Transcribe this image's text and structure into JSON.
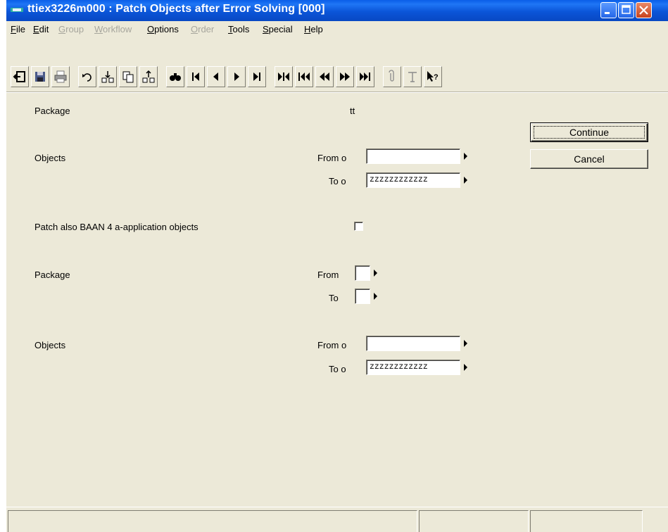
{
  "window": {
    "title": "ttiex3226m000 : Patch Objects after Error Solving [000]"
  },
  "menubar": {
    "items": [
      {
        "label": "File",
        "disabled": false
      },
      {
        "label": "Edit",
        "disabled": false
      },
      {
        "label": "Group",
        "disabled": true
      },
      {
        "label": "Workflow",
        "disabled": true
      },
      {
        "label": "Options",
        "disabled": false
      },
      {
        "label": "Order",
        "disabled": true
      },
      {
        "label": "Tools",
        "disabled": false
      },
      {
        "label": "Special",
        "disabled": false
      },
      {
        "label": "Help",
        "disabled": false
      }
    ]
  },
  "toolbar": {
    "icons": [
      "exit-icon",
      "save-icon",
      "print-icon",
      "undo-icon",
      "insert-icon",
      "copy-icon",
      "duplicate-icon",
      "find-icon",
      "first-record-icon",
      "previous-record-icon",
      "next-record-icon",
      "last-record-icon",
      "first-set-icon",
      "first-group-icon",
      "previous-group-icon",
      "next-group-icon",
      "last-group-icon",
      "attachment-icon",
      "text-icon",
      "context-help-icon"
    ]
  },
  "form": {
    "package_label": "Package",
    "package_value": "tt",
    "objects_label": "Objects",
    "objects_from_label": "From o",
    "objects_from_value": "",
    "objects_to_label": "To o",
    "objects_to_value": "zzzzzzzzzzzz",
    "patch_also_label": "Patch also BAAN 4 a-application objects",
    "patch_also_checked": false,
    "package2_label": "Package",
    "package2_from_label": "From",
    "package2_from_value": "",
    "package2_to_label": "To",
    "package2_to_value": "",
    "objects2_label": "Objects",
    "objects2_from_label": "From o",
    "objects2_from_value": "",
    "objects2_to_label": "To o",
    "objects2_to_value": "zzzzzzzzzzzz"
  },
  "buttons": {
    "continue": "Continue",
    "cancel": "Cancel"
  },
  "colors": {
    "titlebar": "#0a5ee8",
    "window_face": "#ece9d8"
  }
}
